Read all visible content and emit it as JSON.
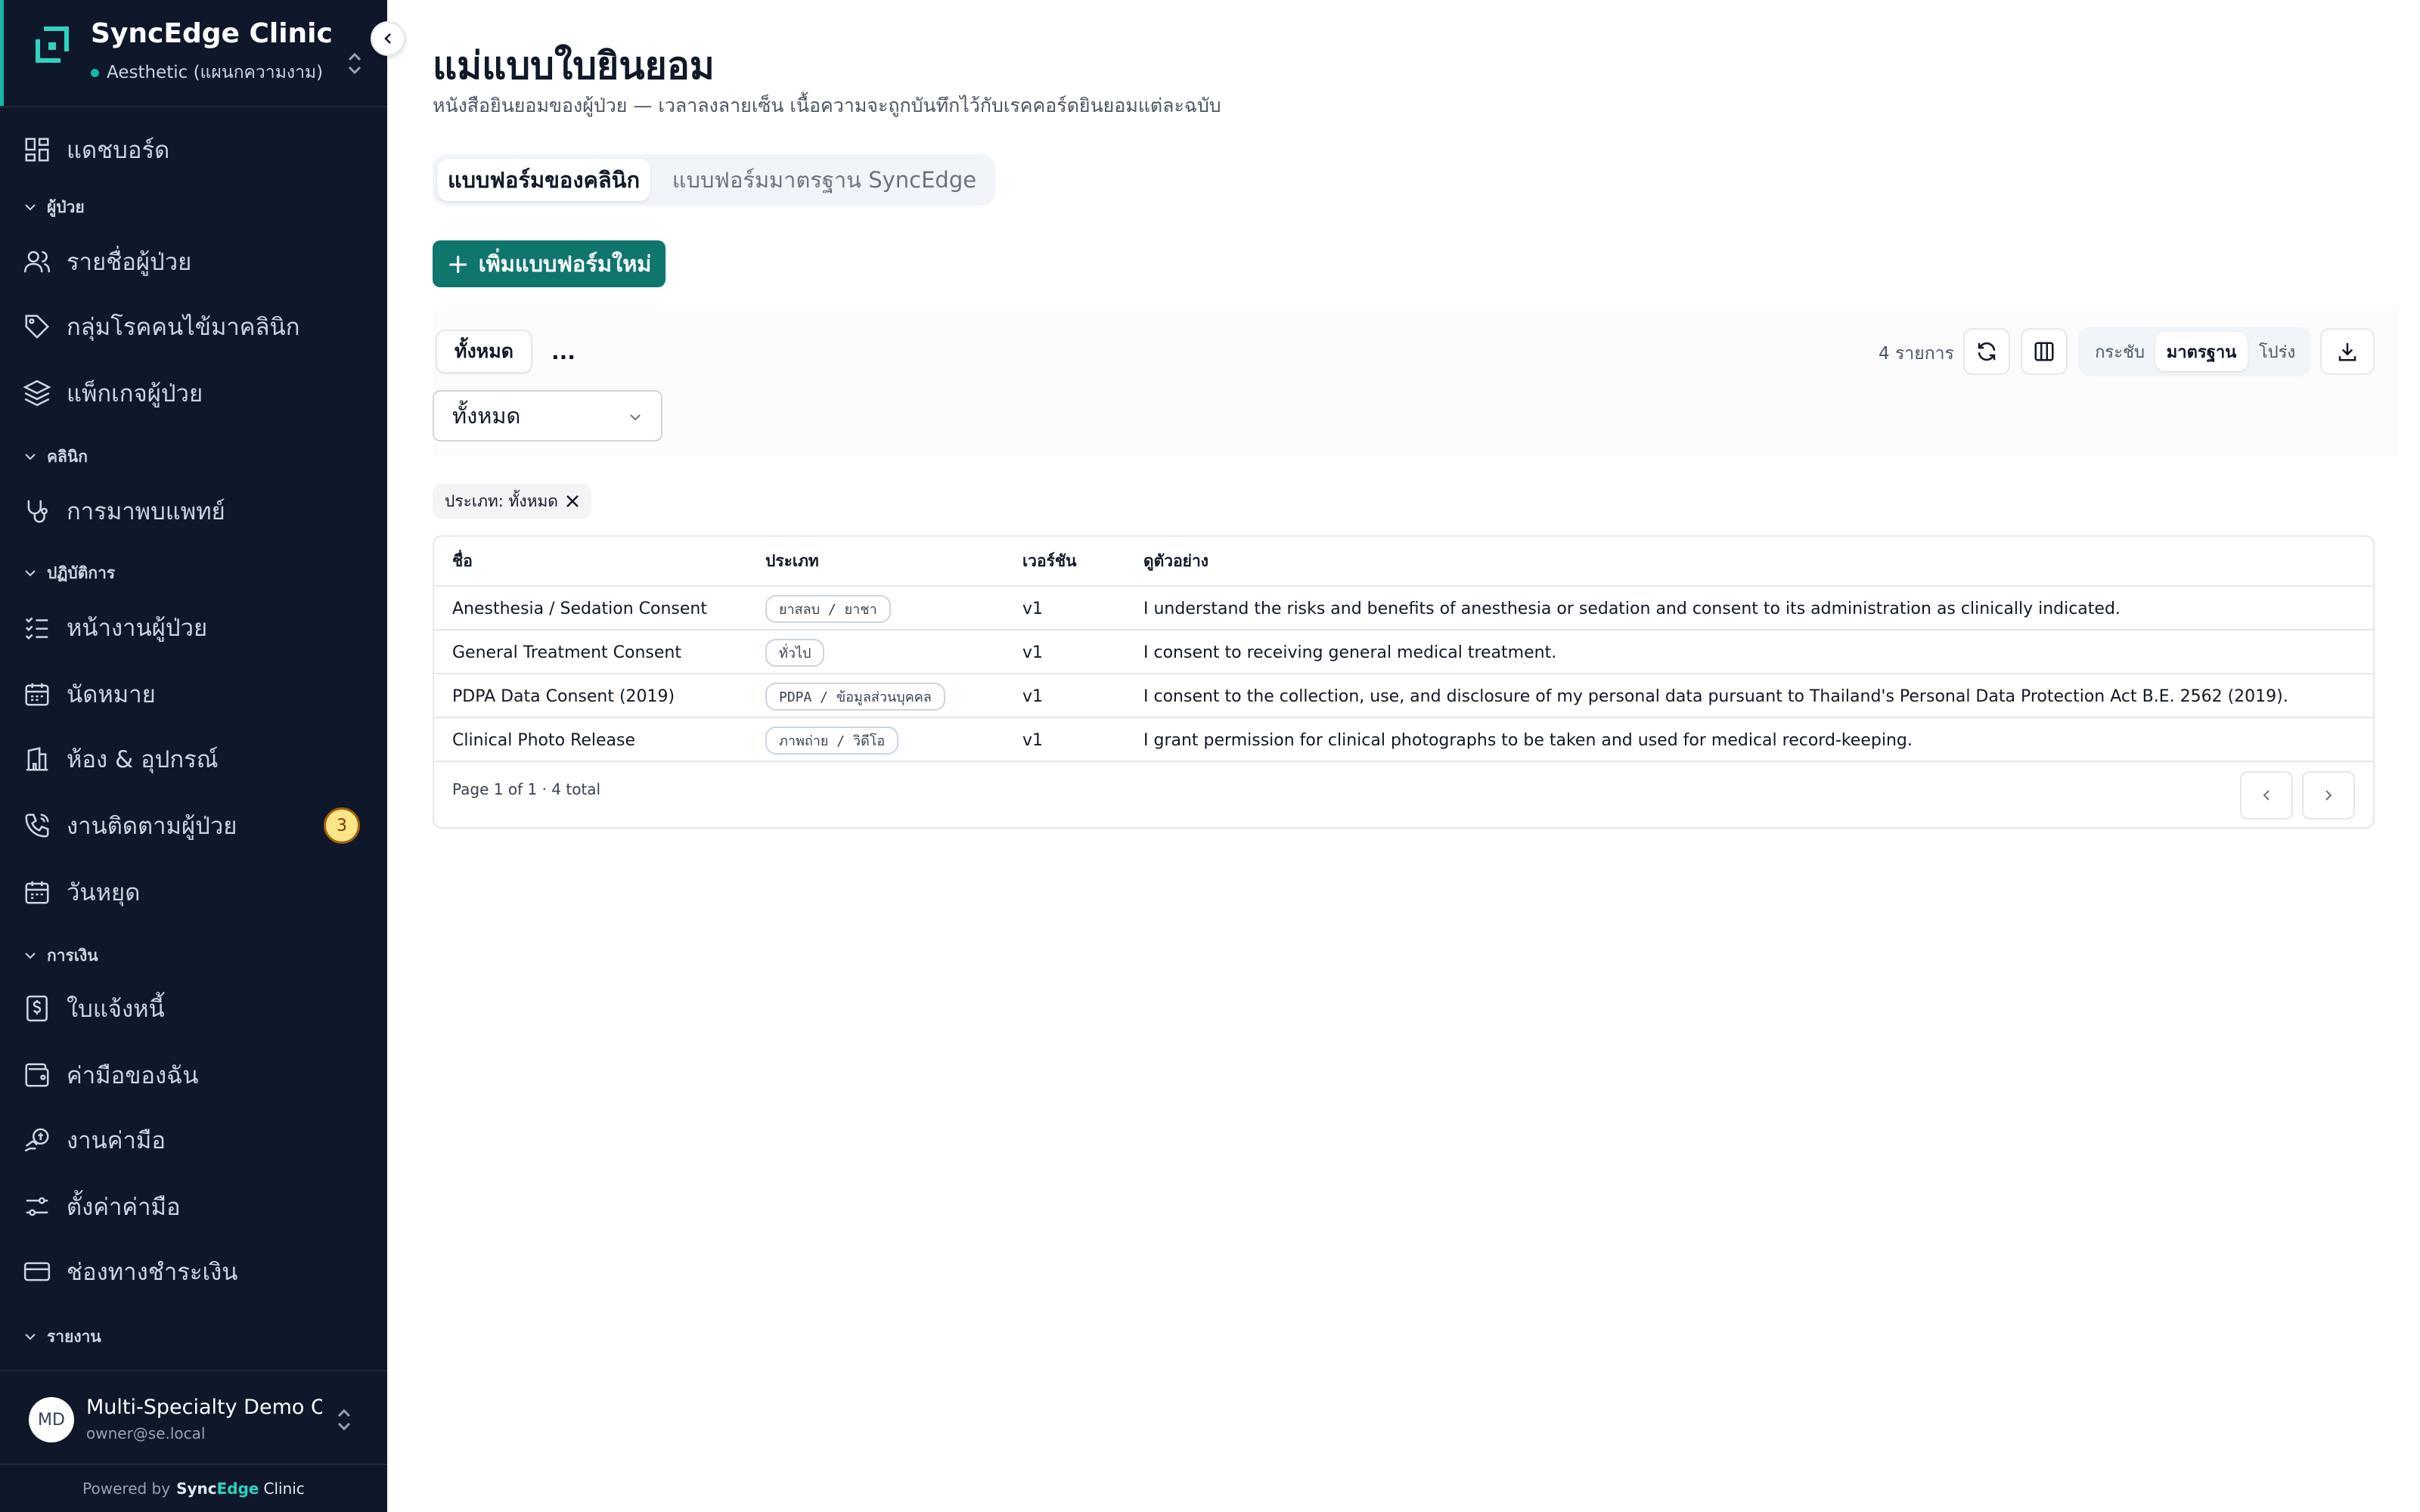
{
  "sidebar": {
    "brand": "SyncEdge Clinic",
    "department": "Aesthetic (แผนกความงาม)",
    "items": {
      "dashboard": "แดชบอร์ด",
      "patients_section": "ผู้ป่วย",
      "patient_list": "รายชื่อผู้ป่วย",
      "disease_groups": "กลุ่มโรคคนไข้มาคลินิก",
      "patient_packages": "แพ็กเกจผู้ป่วย",
      "clinic_section": "คลินิก",
      "doctor_visits": "การมาพบแพทย์",
      "operations_section": "ปฏิบัติการ",
      "patient_tasks": "หน้างานผู้ป่วย",
      "appointments": "นัดหมาย",
      "rooms_equipment": "ห้อง & อุปกรณ์",
      "followups": "งานติดตามผู้ป่วย",
      "followups_badge": "3",
      "holidays": "วันหยุด",
      "finance_section": "การเงิน",
      "invoices": "ใบแจ้งหนี้",
      "my_fees": "ค่ามือของฉัน",
      "fee_jobs": "งานค่ามือ",
      "fee_settings": "ตั้งค่าค่ามือ",
      "payment_channels": "ช่องทางชำระเงิน",
      "reports_section": "รายงาน"
    },
    "user": {
      "initials": "MD",
      "name": "Multi-Specialty Demo Owner",
      "email": "owner@se.local"
    },
    "powered_prefix": "Powered by",
    "powered_sync": "Sync",
    "powered_edge": "Edge",
    "powered_clinic": "Clinic"
  },
  "header": {
    "title": "แม่แบบใบยินยอม",
    "subtitle": "หนังสือยินยอมของผู้ป่วย — เวลาลงลายเซ็น เนื้อความจะถูกบันทึกไว้กับเรคคอร์ดยินยอมแต่ละฉบับ"
  },
  "tabs": {
    "clinic": "แบบฟอร์มของคลินิก",
    "standard": "แบบฟอร์มมาตรฐาน SyncEdge"
  },
  "add_button": "เพิ่มแบบฟอร์มใหม่",
  "toolbar": {
    "all_chip": "ทั้งหมด",
    "more": "...",
    "select_value": "ทั้งหมด",
    "count": "4 รายการ",
    "density": {
      "compact": "กระชับ",
      "standard": "มาตรฐาน",
      "comfortable": "โปร่ง"
    }
  },
  "filter_tag": "ประเภท: ทั้งหมด",
  "table": {
    "headers": {
      "name": "ชื่อ",
      "type": "ประเภท",
      "version": "เวอร์ชัน",
      "preview": "ดูตัวอย่าง"
    },
    "rows": [
      {
        "name": "Anesthesia / Sedation Consent",
        "type": "ยาสลบ / ยาชา",
        "version": "v1",
        "preview": "I understand the risks and benefits of anesthesia or sedation and consent to its administration as clinically indicated."
      },
      {
        "name": "General Treatment Consent",
        "type": "ทั่วไป",
        "version": "v1",
        "preview": "I consent to receiving general medical treatment."
      },
      {
        "name": "PDPA Data Consent (2019)",
        "type": "PDPA / ข้อมูลส่วนบุคคล",
        "version": "v1",
        "preview": "I consent to the collection, use, and disclosure of my personal data pursuant to Thailand's Personal Data Protection Act B.E. 2562 (2019)."
      },
      {
        "name": "Clinical Photo Release",
        "type": "ภาพถ่าย / วิดีโอ",
        "version": "v1",
        "preview": "I grant permission for clinical photographs to be taken and used for medical record-keeping."
      }
    ],
    "pager": "Page 1 of 1 · 4 total"
  },
  "colors": {
    "sidebar_bg": "#0f172a",
    "accent": "#14b8a6",
    "primary_button": "#0f766e",
    "badge": "#fde68a"
  }
}
